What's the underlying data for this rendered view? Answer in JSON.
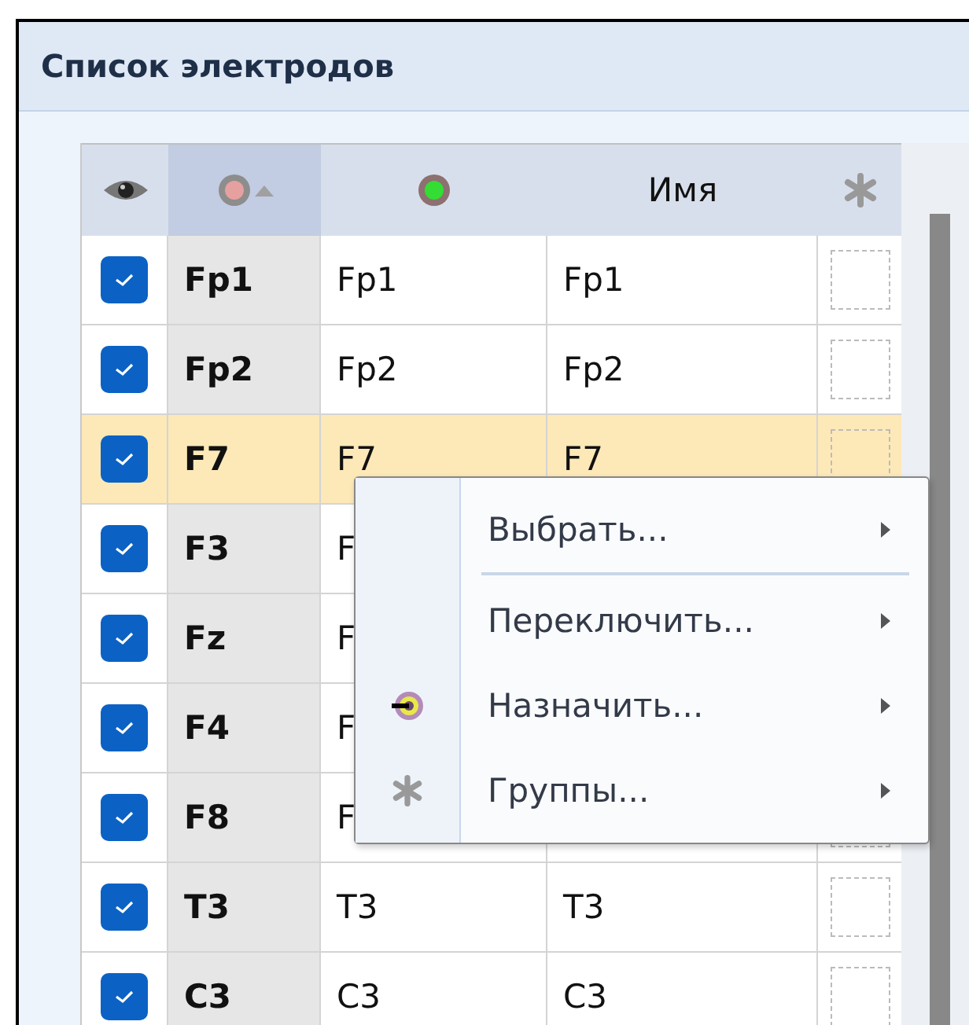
{
  "panel": {
    "title": "Список электродов"
  },
  "table": {
    "columns": [
      {
        "kind": "eye"
      },
      {
        "kind": "ref",
        "sorted": true
      },
      {
        "kind": "active"
      },
      {
        "kind": "text",
        "label": "Имя"
      },
      {
        "kind": "group"
      }
    ],
    "rows": [
      {
        "checked": true,
        "electrode": "Fp1",
        "column_3": "Fp1",
        "name": "Fp1",
        "selected": false
      },
      {
        "checked": true,
        "electrode": "Fp2",
        "column_3": "Fp2",
        "name": "Fp2",
        "selected": false
      },
      {
        "checked": true,
        "electrode": "F7",
        "column_3": "F7",
        "name": "F7",
        "selected": true
      },
      {
        "checked": true,
        "electrode": "F3",
        "column_3": "F",
        "selected": false
      },
      {
        "checked": true,
        "electrode": "Fz",
        "column_3": "F",
        "selected": false
      },
      {
        "checked": true,
        "electrode": "F4",
        "column_3": "F",
        "selected": false
      },
      {
        "checked": true,
        "electrode": "F8",
        "column_3": "F",
        "selected": false
      },
      {
        "checked": true,
        "electrode": "T3",
        "column_3": "T3",
        "name": "T3",
        "selected": false
      },
      {
        "checked": true,
        "electrode": "C3",
        "column_3": "C3",
        "name": "C3",
        "selected": false
      }
    ]
  },
  "context_menu": {
    "items": [
      {
        "label": "Выбрать...",
        "separator_after": true
      },
      {
        "label": "Переключить...",
        "separator_after": false
      },
      {
        "label": "Назначить...",
        "separator_after": false
      },
      {
        "label": "Группы...",
        "separator_after": false
      }
    ]
  }
}
